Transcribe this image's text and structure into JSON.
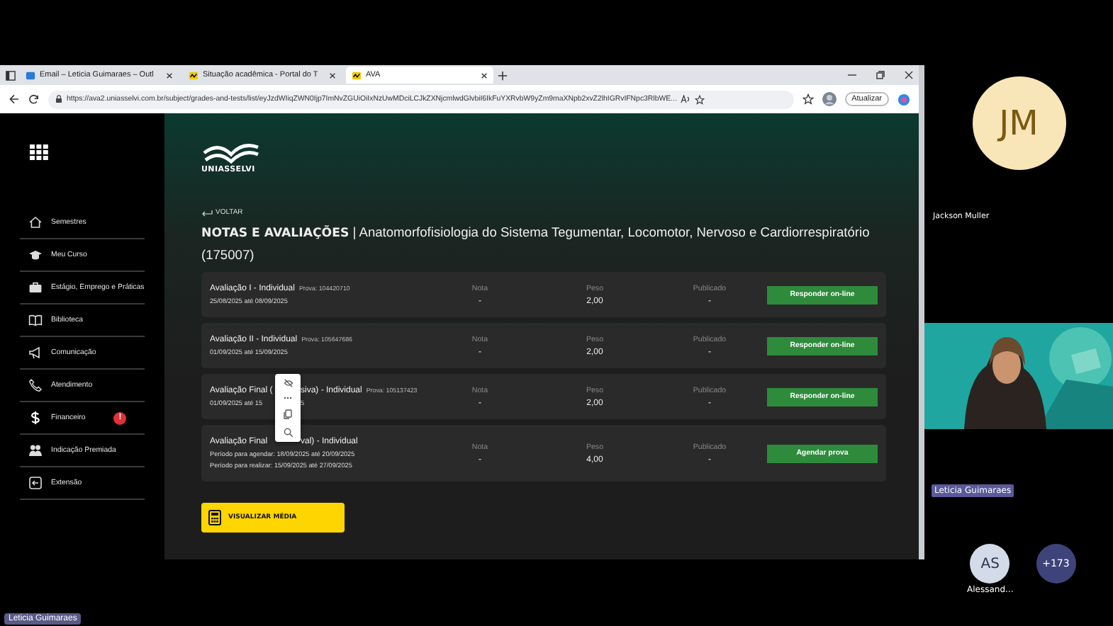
{
  "browser": {
    "tabs": [
      {
        "label": "Email – Leticia Guimaraes – Outl",
        "selected": false
      },
      {
        "label": "Situação acadêmica - Portal do T",
        "selected": false
      },
      {
        "label": "AVA",
        "selected": true
      }
    ],
    "url": "https://ava2.uniasselvi.com.br/subject/grades-and-tests/list/eyJzdWIiqZWN0Ijp7ImNvZGUiOiIxNzUwMDciLCJkZXNjcmlwdGlvbiI6IkFuYXRvbW9yZm9maXNpb2xvZ2lhIGRvIFNpc3RlbWE...",
    "update_button": "Atualizar"
  },
  "sidebar": {
    "items": [
      {
        "label": "Semestres"
      },
      {
        "label": "Meu Curso"
      },
      {
        "label": "Estágio, Emprego e Práticas"
      },
      {
        "label": "Biblioteca"
      },
      {
        "label": "Comunicação"
      },
      {
        "label": "Atendimento"
      },
      {
        "label": "Financeiro",
        "badge": "!"
      },
      {
        "label": "Indicação Premiada"
      },
      {
        "label": "Extensão"
      }
    ]
  },
  "page": {
    "logo": "UNIASSELVI",
    "back": "VOLTAR",
    "heading": "**NOTAS E AVALIAÇÕES** | Anatomorfofisiologia do Sistema Tegumentar, Locomotor, Nervoso e Cardiorrespiratório (175007)",
    "assessments": [
      {
        "title": [
          "Avaliação I - Individual"
        ],
        "exam_code": "Prova: 104420710",
        "dates": [
          [
            "25/08/2025 até 08/09/2025"
          ]
        ],
        "grade_label": "Nota",
        "grade": "-",
        "weight_label": "Peso",
        "weight": "2,00",
        "published_label": "Publicado",
        "published": "-",
        "action": "Responder on-line"
      },
      {
        "title": [
          "Avaliação II - Individual"
        ],
        "exam_code": "Prova: 105647686",
        "dates": [
          [
            "01/09/2025 até 15/09/2025"
          ]
        ],
        "grade_label": "Nota",
        "grade": "-",
        "weight_label": "Peso",
        "weight": "2,00",
        "published_label": "Publicado",
        "published": "-",
        "action": "Responder on-line"
      },
      {
        "title": [
          "Avaliação Final (",
          "siva) - Individual"
        ],
        "exam_code": "Prova: 105137423",
        "dates": [
          [
            "01/09/2025 até 15",
            "5"
          ]
        ],
        "grade_label": "Nota",
        "grade": "-",
        "weight_label": "Peso",
        "weight": "2,00",
        "published_label": "Publicado",
        "published": "-",
        "action": "Responder on-line"
      },
      {
        "title": [
          "Avaliação Final",
          "val) - Individual"
        ],
        "dates": [
          [
            "Período para agendar: 18/09/2025 até 20/09/2025"
          ],
          [
            "Período para realizar: 15/09/2025 até 27/09/2025"
          ]
        ],
        "grade_label": "Nota",
        "grade": "-",
        "weight_label": "Peso",
        "weight": "4,00",
        "published_label": "Publicado",
        "published": "-",
        "action": "Agendar prova"
      }
    ],
    "average_button": "VISUALIZAR MÉDIA"
  },
  "call": {
    "presenter": "Leticia Guimaraes",
    "tiles": [
      {
        "kind": "avatar",
        "initials": "JM",
        "name": "Jackson Muller"
      },
      {
        "kind": "video",
        "name": "Leticia Guimaraes"
      }
    ],
    "others": [
      {
        "initials": "AS",
        "name": "Alessand..."
      },
      {
        "initials": "+173"
      }
    ]
  }
}
